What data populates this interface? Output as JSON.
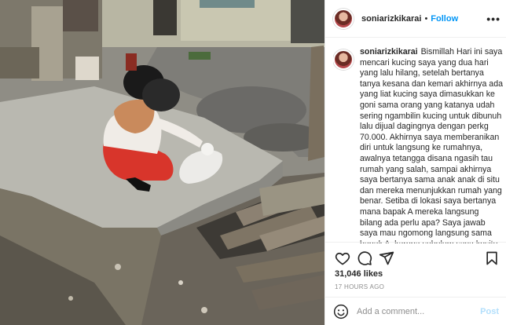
{
  "header": {
    "username": "soniarizkikarai",
    "separator": "•",
    "follow_label": "Follow",
    "more_label": "•••"
  },
  "caption": {
    "username": "soniarizkikarai",
    "text": "Bismillah Hari ini saya mencari kucing saya yang dua hari yang lalu hilang, setelah bertanya tanya kesana dan kemari akhirnya ada yang liat kucing saya dimasukkan ke goni sama orang yang katanya udah sering ngambilin kucing untuk dibunuh lalu dijual dagingnya dengan perkg 70.000. Akhirnya saya memberanikan diri untuk langsung ke rumahnya, awalnya tetangga disana ngasih tau rumah yang salah, sampai akhirnya saya bertanya sama anak anak di situ dan mereka menunjukkan rumah yang benar. Setiba di lokasi saya bertanya mana bapak A mereka langsung bilang ada perlu apa? Saya jawab saya mau ngomong langsung sama bapak A, karena sebelum saya kesitu saya diperingati jangan"
  },
  "actions": {
    "like_icon": "heart-icon",
    "comment_icon": "comment-bubble-icon",
    "share_icon": "paper-plane-icon",
    "save_icon": "bookmark-icon"
  },
  "likes": "31,046 likes",
  "timestamp": "17 HOURS AGO",
  "comment_box": {
    "placeholder": "Add a comment...",
    "post_label": "Post",
    "emoji_icon": "smiley-icon"
  },
  "colors": {
    "accent": "#0095f6",
    "post_disabled": "#b2dffc",
    "muted": "#8e8e8e"
  }
}
